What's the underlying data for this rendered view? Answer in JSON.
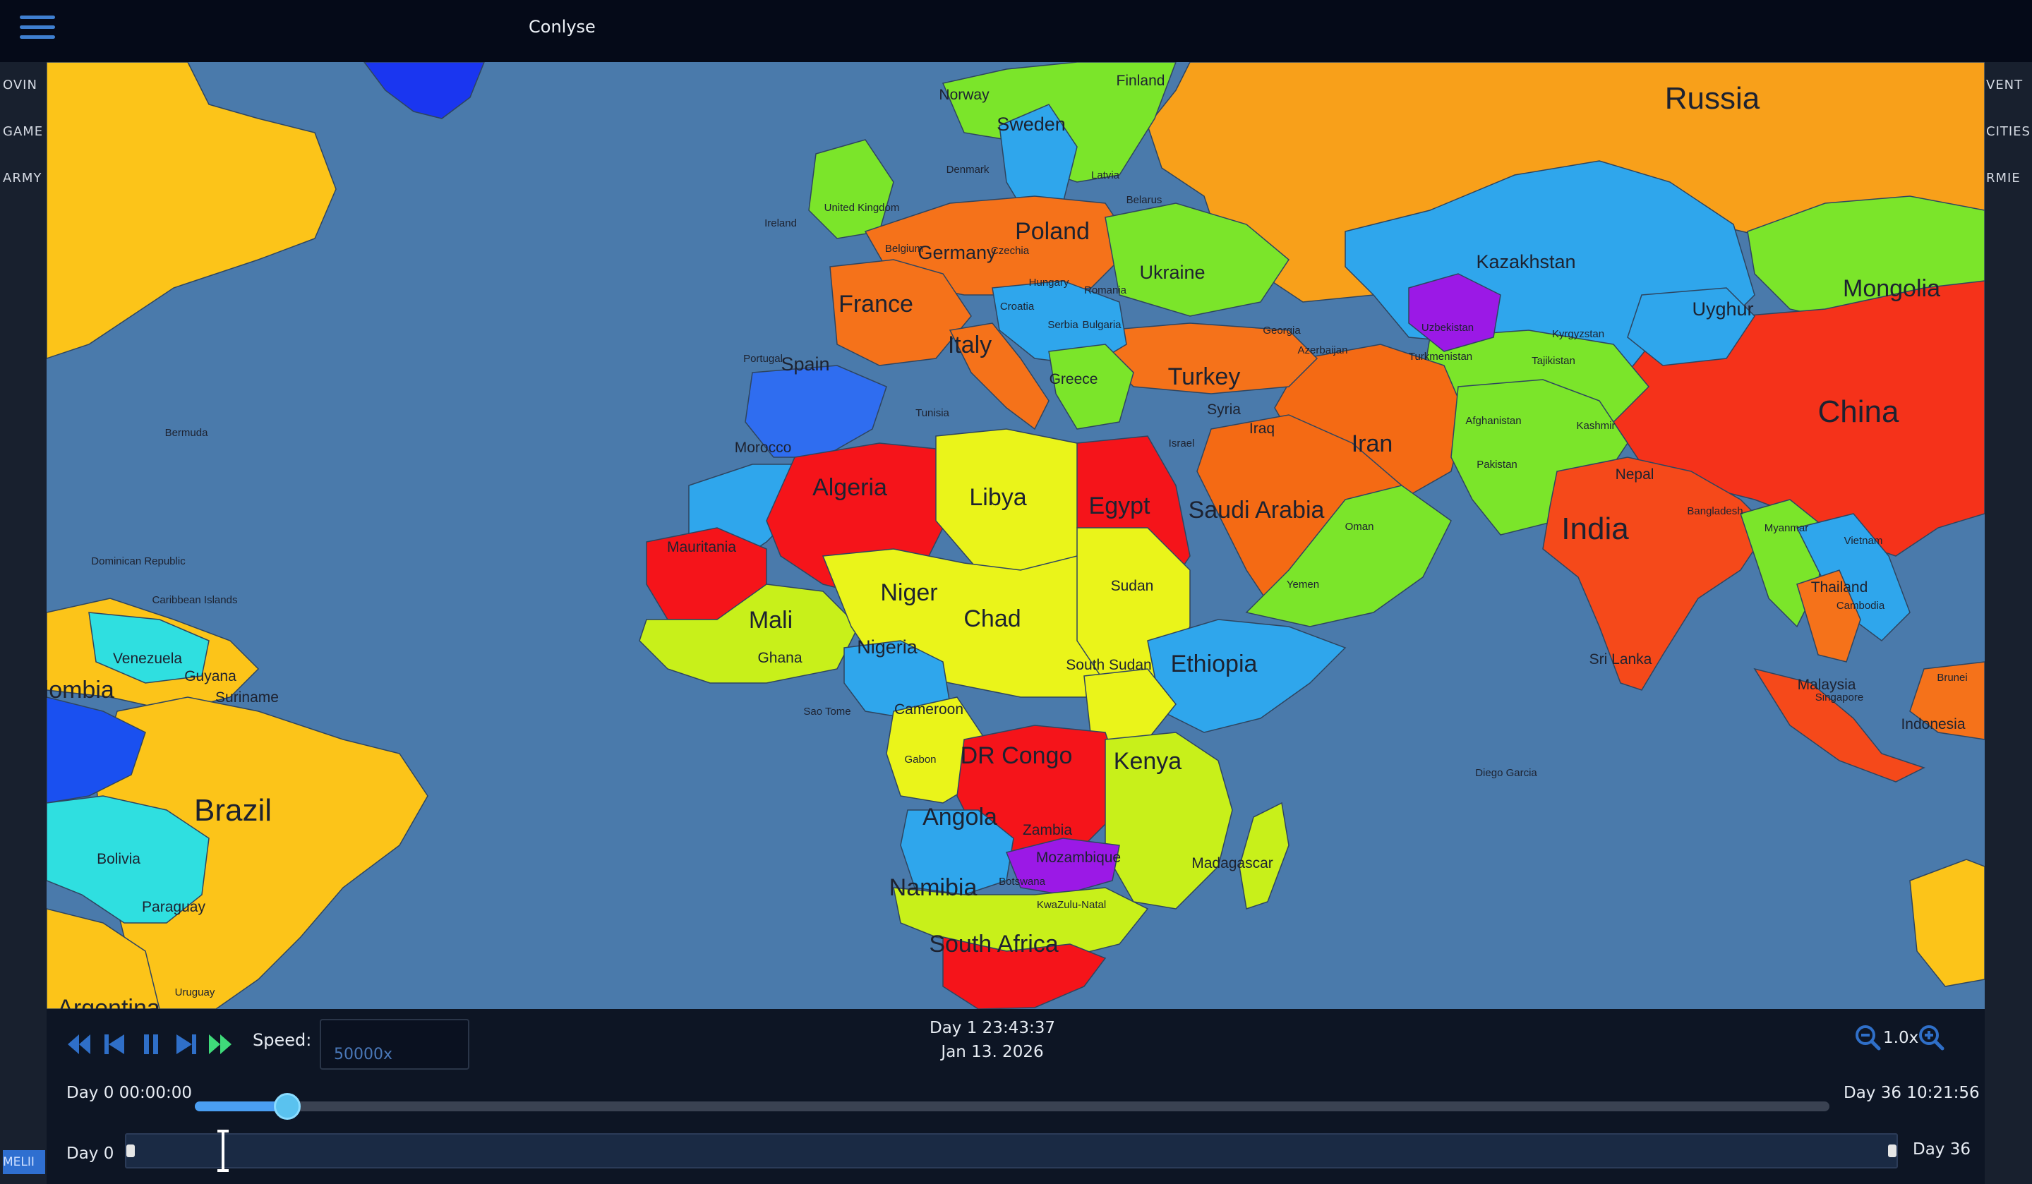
{
  "app": {
    "title": "Conlyse"
  },
  "topbar": {
    "menu_icon": "hamburger-menu-icon"
  },
  "left_tabs": [
    "OVIN",
    "GAME",
    "ARMY"
  ],
  "left_bottom_tab": "MELII",
  "right_tabs": [
    "VENT",
    "CITIES",
    "RMIE"
  ],
  "map": {
    "ocean_color": "#4a7aab",
    "labels": [
      {
        "name": "Russia",
        "size": "xl"
      },
      {
        "name": "Finland",
        "size": "s"
      },
      {
        "name": "Norway",
        "size": "s"
      },
      {
        "name": "Sweden",
        "size": "m"
      },
      {
        "name": "Denmark",
        "size": "xs"
      },
      {
        "name": "Latvia",
        "size": "xs"
      },
      {
        "name": "Ireland",
        "size": "xs"
      },
      {
        "name": "United Kingdom",
        "size": "xs"
      },
      {
        "name": "Belarus",
        "size": "xs"
      },
      {
        "name": "Poland",
        "size": "l"
      },
      {
        "name": "Germany",
        "size": "m"
      },
      {
        "name": "Belgium",
        "size": "xs"
      },
      {
        "name": "Czechia",
        "size": "xs"
      },
      {
        "name": "Ukraine",
        "size": "m"
      },
      {
        "name": "Hungary",
        "size": "xs"
      },
      {
        "name": "Romania",
        "size": "xs"
      },
      {
        "name": "France",
        "size": "l"
      },
      {
        "name": "Croatia",
        "size": "xs"
      },
      {
        "name": "Serbia",
        "size": "xs"
      },
      {
        "name": "Bulgaria",
        "size": "xs"
      },
      {
        "name": "Italy",
        "size": "l"
      },
      {
        "name": "Portugal",
        "size": "xs"
      },
      {
        "name": "Spain",
        "size": "m"
      },
      {
        "name": "Greece",
        "size": "s"
      },
      {
        "name": "Turkey",
        "size": "l"
      },
      {
        "name": "Georgia",
        "size": "xs"
      },
      {
        "name": "Azerbaijan",
        "size": "xs"
      },
      {
        "name": "Kazakhstan",
        "size": "m"
      },
      {
        "name": "Uzbekistan",
        "size": "xs"
      },
      {
        "name": "Kyrgyzstan",
        "size": "xs"
      },
      {
        "name": "Turkmenistan",
        "size": "xs"
      },
      {
        "name": "Tajikistan",
        "size": "xs"
      },
      {
        "name": "Uyghur",
        "size": "m"
      },
      {
        "name": "Mongolia",
        "size": "l"
      },
      {
        "name": "China",
        "size": "xl"
      },
      {
        "name": "Tunisia",
        "size": "xs"
      },
      {
        "name": "Morocco",
        "size": "s"
      },
      {
        "name": "Algeria",
        "size": "l"
      },
      {
        "name": "Libya",
        "size": "l"
      },
      {
        "name": "Egypt",
        "size": "l"
      },
      {
        "name": "Israel",
        "size": "xs"
      },
      {
        "name": "Syria",
        "size": "s"
      },
      {
        "name": "Iraq",
        "size": "s"
      },
      {
        "name": "Iran",
        "size": "l"
      },
      {
        "name": "Afghanistan",
        "size": "xs"
      },
      {
        "name": "Kashmir",
        "size": "xs"
      },
      {
        "name": "Pakistan",
        "size": "xs"
      },
      {
        "name": "Nepal",
        "size": "s"
      },
      {
        "name": "Bangladesh",
        "size": "xs"
      },
      {
        "name": "Saudi Arabia",
        "size": "l"
      },
      {
        "name": "Oman",
        "size": "xs"
      },
      {
        "name": "Yemen",
        "size": "xs"
      },
      {
        "name": "India",
        "size": "xl"
      },
      {
        "name": "Myanmar",
        "size": "xs"
      },
      {
        "name": "Vietnam",
        "size": "xs"
      },
      {
        "name": "Thailand",
        "size": "s"
      },
      {
        "name": "Cambodia",
        "size": "xs"
      },
      {
        "name": "Sri Lanka",
        "size": "s"
      },
      {
        "name": "Malaysia",
        "size": "s"
      },
      {
        "name": "Singapore",
        "size": "xs"
      },
      {
        "name": "Brunei",
        "size": "xs"
      },
      {
        "name": "Indonesia",
        "size": "s"
      },
      {
        "name": "Diego Garcia",
        "size": "xs"
      },
      {
        "name": "Mauritania",
        "size": "s"
      },
      {
        "name": "Mali",
        "size": "l"
      },
      {
        "name": "Niger",
        "size": "l"
      },
      {
        "name": "Chad",
        "size": "l"
      },
      {
        "name": "Sudan",
        "size": "s"
      },
      {
        "name": "Ghana",
        "size": "s"
      },
      {
        "name": "Nigeria",
        "size": "m"
      },
      {
        "name": "Ethiopia",
        "size": "l"
      },
      {
        "name": "South Sudan",
        "size": "s"
      },
      {
        "name": "Sao Tome",
        "size": "xs"
      },
      {
        "name": "Cameroon",
        "size": "s"
      },
      {
        "name": "Gabon",
        "size": "xs"
      },
      {
        "name": "DR Congo",
        "size": "l"
      },
      {
        "name": "Kenya",
        "size": "l"
      },
      {
        "name": "Angola",
        "size": "l"
      },
      {
        "name": "Zambia",
        "size": "s"
      },
      {
        "name": "Mozambique",
        "size": "s"
      },
      {
        "name": "Madagascar",
        "size": "s"
      },
      {
        "name": "Namibia",
        "size": "l"
      },
      {
        "name": "Botswana",
        "size": "xs"
      },
      {
        "name": "KwaZulu-Natal",
        "size": "xs"
      },
      {
        "name": "South Africa",
        "size": "l"
      },
      {
        "name": "Bermuda",
        "size": "xs"
      },
      {
        "name": "Dominican Republic",
        "size": "xs"
      },
      {
        "name": "Caribbean Islands",
        "size": "xs"
      },
      {
        "name": "Venezuela",
        "size": "s"
      },
      {
        "name": "Colombia",
        "size": "l"
      },
      {
        "name": "Guyana",
        "size": "s"
      },
      {
        "name": "Suriname",
        "size": "s"
      },
      {
        "name": "Brazil",
        "size": "xl"
      },
      {
        "name": "Bolivia",
        "size": "s"
      },
      {
        "name": "Paraguay",
        "size": "s"
      },
      {
        "name": "Uruguay",
        "size": "xs"
      },
      {
        "name": "Argentina",
        "size": "l"
      }
    ]
  },
  "controls": {
    "rewind_icon": "fast-rewind-icon",
    "step_back_icon": "step-back-icon",
    "pause_icon": "pause-icon",
    "step_forward_icon": "step-forward-icon",
    "fast_forward_icon": "fast-forward-icon",
    "speed_label": "Speed:",
    "speed_value": "50000x",
    "current_day": "Day 1 23:43:37",
    "current_date": "Jan 13. 2026",
    "zoom_level": "1.0x",
    "start_time": "Day 0 00:00:00",
    "end_time": "Day 36 10:21:56",
    "speed_slider_fraction": 0.05,
    "timeline_start": "Day 0",
    "timeline_end": "Day 36",
    "accent": "#4a9ef2"
  }
}
